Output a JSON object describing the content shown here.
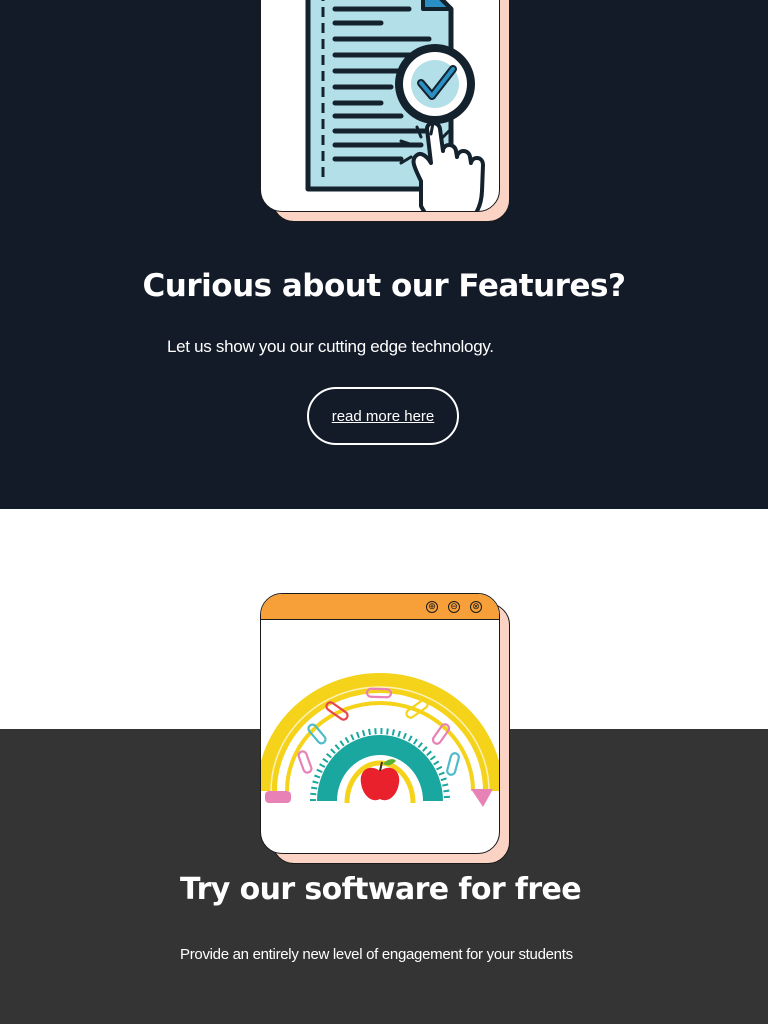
{
  "features": {
    "title": "Curious about our Features?",
    "description": "Let us show you our cutting edge technology.",
    "button_label": "read more here"
  },
  "trial": {
    "title": "Try our software for free",
    "description": "Provide an entirely new level of engagement for your students"
  },
  "window_controls": [
    "⊕",
    "⊖",
    "⊗"
  ],
  "icons": [
    "document-check-icon",
    "pointer-hand-icon",
    "rainbow-school-icon",
    "apple-icon"
  ],
  "colors": {
    "dark_navy": "#131a28",
    "charcoal": "#343434",
    "peach": "#fbd3c4",
    "orange": "#f7a03a",
    "doc_blue": "#b2dfe8"
  }
}
